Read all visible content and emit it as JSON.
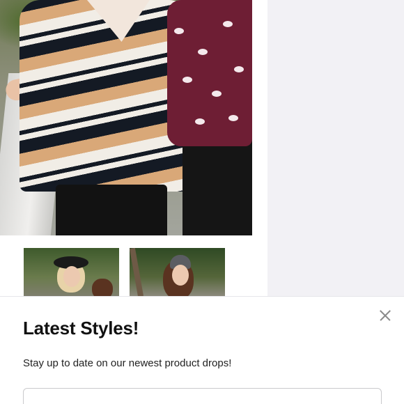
{
  "popup": {
    "title": "Latest Styles!",
    "subtitle": "Stay up to date on our newest product drops!",
    "email_placeholder": ""
  },
  "icons": {
    "close": "close-icon"
  },
  "colors": {
    "side_pane": "#f2f1f5",
    "sheet_background": "#ffffff",
    "input_border": "#c9c9cc"
  }
}
